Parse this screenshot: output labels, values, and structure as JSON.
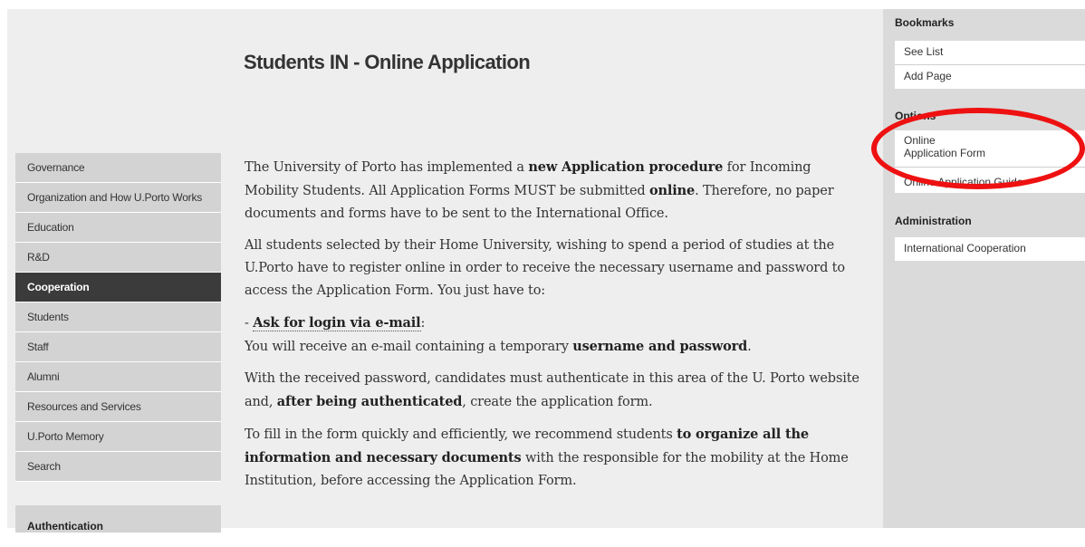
{
  "page": {
    "title": "Students IN - Online Application"
  },
  "left_nav": {
    "items": [
      {
        "label": "Governance",
        "active": false
      },
      {
        "label": "Organization and How U.Porto Works",
        "active": false
      },
      {
        "label": "Education",
        "active": false
      },
      {
        "label": "R&D",
        "active": false
      },
      {
        "label": "Cooperation",
        "active": true
      },
      {
        "label": "Students",
        "active": false
      },
      {
        "label": "Staff",
        "active": false
      },
      {
        "label": "Alumni",
        "active": false
      },
      {
        "label": "Resources and Services",
        "active": false
      },
      {
        "label": "U.Porto Memory",
        "active": false
      },
      {
        "label": "Search",
        "active": false
      }
    ],
    "auth_label": "Authentication"
  },
  "content": {
    "p1": {
      "t1": "The University of Porto has implemented a ",
      "b1": "new Application procedure",
      "t2": " for Incoming Mobility Students. All Application Forms MUST be submitted ",
      "b2": "online",
      "t3": ". Therefore, no paper documents and forms have to be sent to the International Office."
    },
    "p2": "All students selected by their Home University, wishing to spend a period of studies at the U.Porto have to register online in order to receive the necessary username and password to access the Application Form. You just have to:",
    "p3": {
      "dash": "- ",
      "link": "Ask for login via e-mail",
      "colon": ":",
      "t1": "You will receive an e-mail containing a temporary ",
      "b1": "username and password",
      "t2": "."
    },
    "p4": {
      "t1": "With the received password, candidates must authenticate in this area of the U. Porto website and, ",
      "b1": "after being authenticated",
      "t2": ", create the application form."
    },
    "p5": {
      "t1": "To fill in the form quickly and efficiently, we recommend students ",
      "b1": "to organize all the information and necessary documents",
      "t2": " with the responsible for the mobility at the Home Institution, before accessing the Application Form."
    }
  },
  "right_bar": {
    "bookmarks_heading": "Bookmarks",
    "see_list": "See List",
    "add_page": "Add Page",
    "options_heading": "Options",
    "online_line1": "Online",
    "online_line2": "Application Form",
    "online_guide": "Online Application Guide",
    "admin_heading": "Administration",
    "intl_coop": "International Cooperation"
  },
  "colors": {
    "annotation": "#ee1111",
    "nav_active": "#3b3b3b",
    "nav_bg": "#d3d3d3",
    "page_bg": "#eeeeee"
  }
}
